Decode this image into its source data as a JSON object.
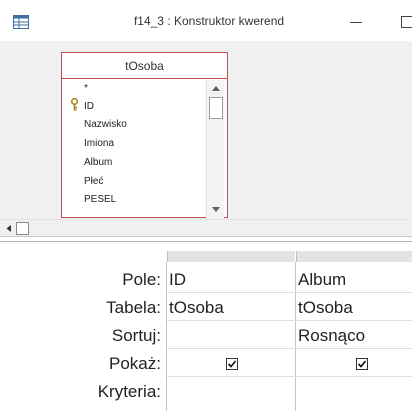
{
  "window": {
    "title": "f14_3 : Konstruktor kwerend"
  },
  "table_box": {
    "title": "tOsoba",
    "fields": [
      "*",
      "ID",
      "Nazwisko",
      "Imiona",
      "Album",
      "Płeć",
      "PESEL"
    ],
    "primary_key_field": "ID",
    "border_color": "#c04c54"
  },
  "grid": {
    "row_labels": {
      "field": "Pole:",
      "table": "Tabela:",
      "sort": "Sortuj:",
      "show": "Pokaż:",
      "criteria": "Kryteria:"
    },
    "columns": [
      {
        "field": "ID",
        "table": "tOsoba",
        "sort": "",
        "show": true,
        "criteria": ""
      },
      {
        "field": "Album",
        "table": "tOsoba",
        "sort": "Rosnąco",
        "show": true,
        "criteria": ""
      }
    ]
  }
}
